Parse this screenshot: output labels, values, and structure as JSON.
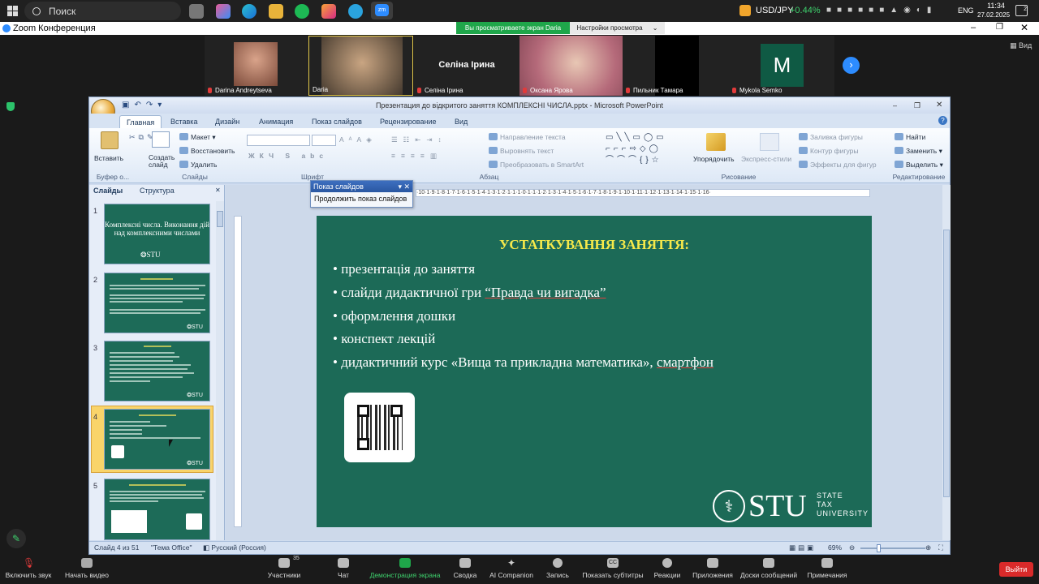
{
  "taskbar": {
    "search_placeholder": "Поиск",
    "currency": "USD/JPY",
    "currency_change": "+0.44%",
    "lang": "ENG",
    "time": "11:34",
    "date": "27.02.2025",
    "notif_count": "2"
  },
  "zoom": {
    "title": "Zoom Конференция",
    "share_banner": "Вы просматриваете экран Daria",
    "view_settings": "Настройки просмотра",
    "view_label": "Вид",
    "participants": [
      {
        "name": "Darina Andreytseva"
      },
      {
        "name": "Daria"
      },
      {
        "name": "Селіна Ірина",
        "big_name": "Селіна Ірина"
      },
      {
        "name": "Оксана Ярова"
      },
      {
        "name": "Пильник Тамара"
      },
      {
        "name": "Mykola Semko",
        "initial": "M"
      }
    ],
    "toolbar": [
      {
        "label": "Включить звук"
      },
      {
        "label": "Начать видео"
      },
      {
        "label": "Участники",
        "count": "35"
      },
      {
        "label": "Чат"
      },
      {
        "label": "Демонстрация экрана"
      },
      {
        "label": "Сводка"
      },
      {
        "label": "AI Companion"
      },
      {
        "label": "Запись"
      },
      {
        "label": "Показать субтитры"
      },
      {
        "label": "Реакции"
      },
      {
        "label": "Приложения"
      },
      {
        "label": "Доски сообщений"
      },
      {
        "label": "Примечания"
      }
    ],
    "leave_label": "Выйти"
  },
  "ppt": {
    "window_title": "Презентация до відкритого заняття КОМПЛЕКСНІ ЧИСЛА.pptx - Microsoft PowerPoint",
    "tabs": [
      "Главная",
      "Вставка",
      "Дизайн",
      "Анимация",
      "Показ слайдов",
      "Рецензирование",
      "Вид"
    ],
    "ribbon": {
      "paste": "Вставить",
      "create_slide": "Создать слайд",
      "layout": "Макет",
      "reset": "Восстановить",
      "delete": "Удалить",
      "clipboard_group": "Буфер о...",
      "slides_group": "Слайды",
      "font_group": "Шрифт",
      "paragraph_group": "Абзац",
      "text_direction": "Направление текста",
      "align_text": "Выровнять текст",
      "smartart": "Преобразовать в SmartArt",
      "arrange": "Упорядочить",
      "express_styles": "Экспресс-стили",
      "shape_fill": "Заливка фигуры",
      "shape_outline": "Контур фигуры",
      "shape_effects": "Эффекты для фигур",
      "drawing_group": "Рисование",
      "find": "Найти",
      "replace": "Заменить",
      "select": "Выделить",
      "editing_group": "Редактирование"
    },
    "panel_tabs": [
      "Слайды",
      "Структура"
    ],
    "thumbs": [
      {
        "num": "1",
        "title": "Комплексні числа. Виконання дій над комплексними числами"
      },
      {
        "num": "2"
      },
      {
        "num": "3"
      },
      {
        "num": "4"
      },
      {
        "num": "5"
      }
    ],
    "slideshow_popup": {
      "title": "Показ слайдов",
      "button": "Продолжить показ слайдов"
    },
    "ruler_text": "·10·1·9·1·8·1·7·1·6·1·5·1·4·1·3·1·2·1·1·1·0·1·1·1·2·1·3·1·4·1·5·1·6·1·7·1·8·1·9·1·10·1·11·1·12·1·13·1·14·1·15·1·16·",
    "slide": {
      "title": "УСТАТКУВАННЯ ЗАНЯТТЯ:",
      "bullets": [
        "• презентація до заняття",
        "• слайди дидактичної гри ",
        "• оформлення дошки",
        "• конспект лекцій",
        "• дидактичний курс «Вища та прикладна математика», "
      ],
      "bullet2_quote": "“Правда чи вигадка”",
      "bullet5_tail": "смартфон",
      "logo_text": "STU",
      "logo_sub1": "STATE",
      "logo_sub2": "TAX",
      "logo_sub3": "UNIVERSITY"
    },
    "status": {
      "slide_of": "Слайд 4 из 51",
      "theme": "\"Тема Office\"",
      "language": "Русский (Россия)",
      "zoom": "69%"
    }
  }
}
